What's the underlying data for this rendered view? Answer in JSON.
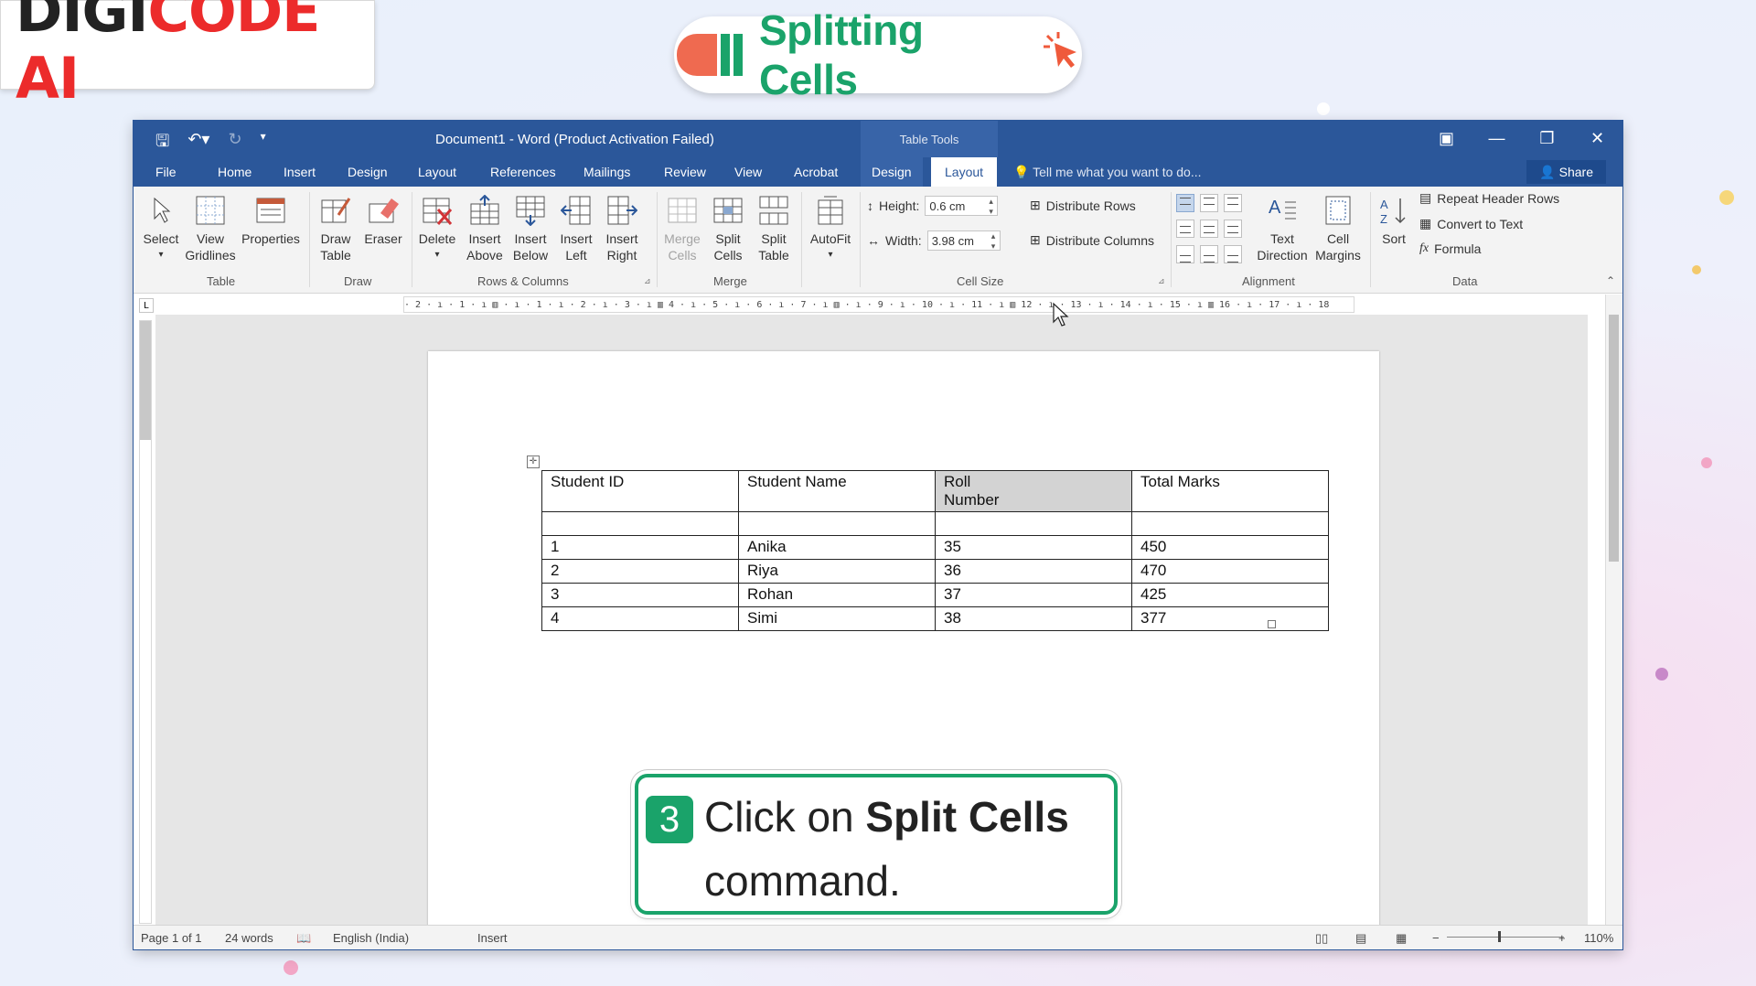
{
  "logo": {
    "part1": "DIGI",
    "part2": "CODE AI"
  },
  "banner": {
    "title": "Splitting Cells"
  },
  "window": {
    "doc_title": "Document1 - Word (Product Activation Failed)",
    "contextual_group": "Table Tools"
  },
  "tabs": [
    "File",
    "Home",
    "Insert",
    "Design",
    "Layout",
    "References",
    "Mailings",
    "Review",
    "View",
    "Acrobat"
  ],
  "context_tabs": {
    "design": "Design",
    "layout": "Layout"
  },
  "tell_me": "Tell me what you want to do...",
  "share": "Share",
  "ribbon": {
    "table": {
      "select": "Select",
      "view_gridlines_1": "View",
      "view_gridlines_2": "Gridlines",
      "properties": "Properties",
      "label": "Table"
    },
    "draw": {
      "draw_table_1": "Draw",
      "draw_table_2": "Table",
      "eraser": "Eraser",
      "label": "Draw"
    },
    "rows_cols": {
      "delete": "Delete",
      "insert_above_1": "Insert",
      "insert_above_2": "Above",
      "insert_below_1": "Insert",
      "insert_below_2": "Below",
      "insert_left_1": "Insert",
      "insert_left_2": "Left",
      "insert_right_1": "Insert",
      "insert_right_2": "Right",
      "label": "Rows & Columns"
    },
    "merge": {
      "merge_cells_1": "Merge",
      "merge_cells_2": "Cells",
      "split_cells_1": "Split",
      "split_cells_2": "Cells",
      "split_table_1": "Split",
      "split_table_2": "Table",
      "label": "Merge"
    },
    "autofit": "AutoFit",
    "cell_size": {
      "height_label": "Height:",
      "height_value": "0.6 cm",
      "width_label": "Width:",
      "width_value": "3.98 cm",
      "distribute_rows": "Distribute Rows",
      "distribute_columns": "Distribute Columns",
      "label": "Cell Size"
    },
    "alignment": {
      "text_direction_1": "Text",
      "text_direction_2": "Direction",
      "cell_margins_1": "Cell",
      "cell_margins_2": "Margins",
      "label": "Alignment"
    },
    "data": {
      "sort": "Sort",
      "repeat_header_rows": "Repeat Header Rows",
      "convert_to_text": "Convert to Text",
      "formula": "Formula",
      "label": "Data"
    }
  },
  "ruler_text": "· 2 · ı · 1 · ı ▥ · ı · 1 · ı · 2 · ı · 3 · ı ▥ 4 · ı · 5 · ı · 6 · ı · 7 · ı ▥ · ı · 9 · ı · 10 · ı · 11 · ı ▥ 12 · ı · 13 · ı · 14 · ı · 15 · ı ▥ 16 · ı · 17 · ı · 18",
  "table": {
    "header": [
      "Student ID",
      "Student Name",
      "Roll Number",
      "Total Marks"
    ],
    "rows": [
      [
        "1",
        "Anika",
        "35",
        "450"
      ],
      [
        "2",
        "Riya",
        "36",
        "470"
      ],
      [
        "3",
        "Rohan",
        "37",
        "425"
      ],
      [
        "4",
        "Simi",
        "38",
        "377"
      ]
    ]
  },
  "status": {
    "page": "Page 1 of 1",
    "words": "24 words",
    "language": "English (India)",
    "mode": "Insert",
    "zoom": "110%"
  },
  "callout": {
    "step": "3",
    "pre": "Click on ",
    "bold": "Split Cells",
    "post": "command."
  },
  "colors": {
    "word_blue": "#2b579a",
    "accent_green": "#1aa36a",
    "logo_red": "#ec2b2b"
  }
}
